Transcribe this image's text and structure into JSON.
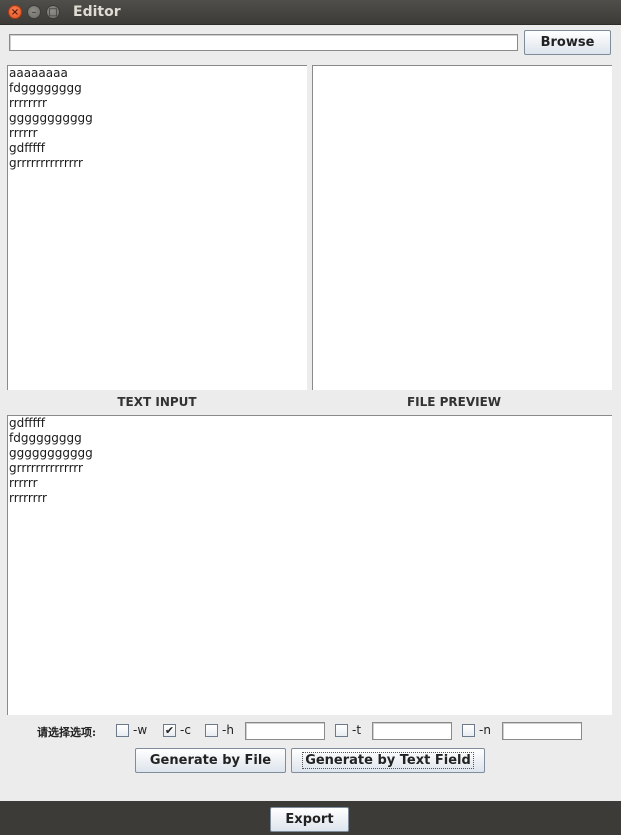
{
  "window": {
    "title": "Editor",
    "close_glyph": "×",
    "min_glyph": "–",
    "max_glyph": "□"
  },
  "toolbar": {
    "path_value": "",
    "browse_label": "Browse"
  },
  "panes": {
    "text_input_lines": [
      "aaaaaaaa",
      "fdgggggggg",
      "rrrrrrrr",
      "ggggggggggg",
      "rrrrrr",
      "gdfffff",
      "grrrrrrrrrrrrrr"
    ],
    "file_preview_lines": [],
    "text_input_heading": "TEXT INPUT",
    "file_preview_heading": "FILE PREVIEW",
    "output_lines": [
      "gdfffff",
      "fdgggggggg",
      "ggggggggggg",
      "grrrrrrrrrrrrrr",
      "rrrrrr",
      "rrrrrrrr"
    ]
  },
  "options": {
    "label": "请选择选项:",
    "w": {
      "label": "-w",
      "checked": false
    },
    "c": {
      "label": "-c",
      "checked": true
    },
    "h": {
      "label": "-h",
      "checked": false,
      "value": ""
    },
    "t": {
      "label": "-t",
      "checked": false,
      "value": ""
    },
    "n": {
      "label": "-n",
      "checked": false,
      "value": ""
    },
    "check_glyph": "✔"
  },
  "actions": {
    "generate_file_label": "Generate by File",
    "generate_text_label": "Generate by Text Field",
    "export_label": "Export"
  }
}
